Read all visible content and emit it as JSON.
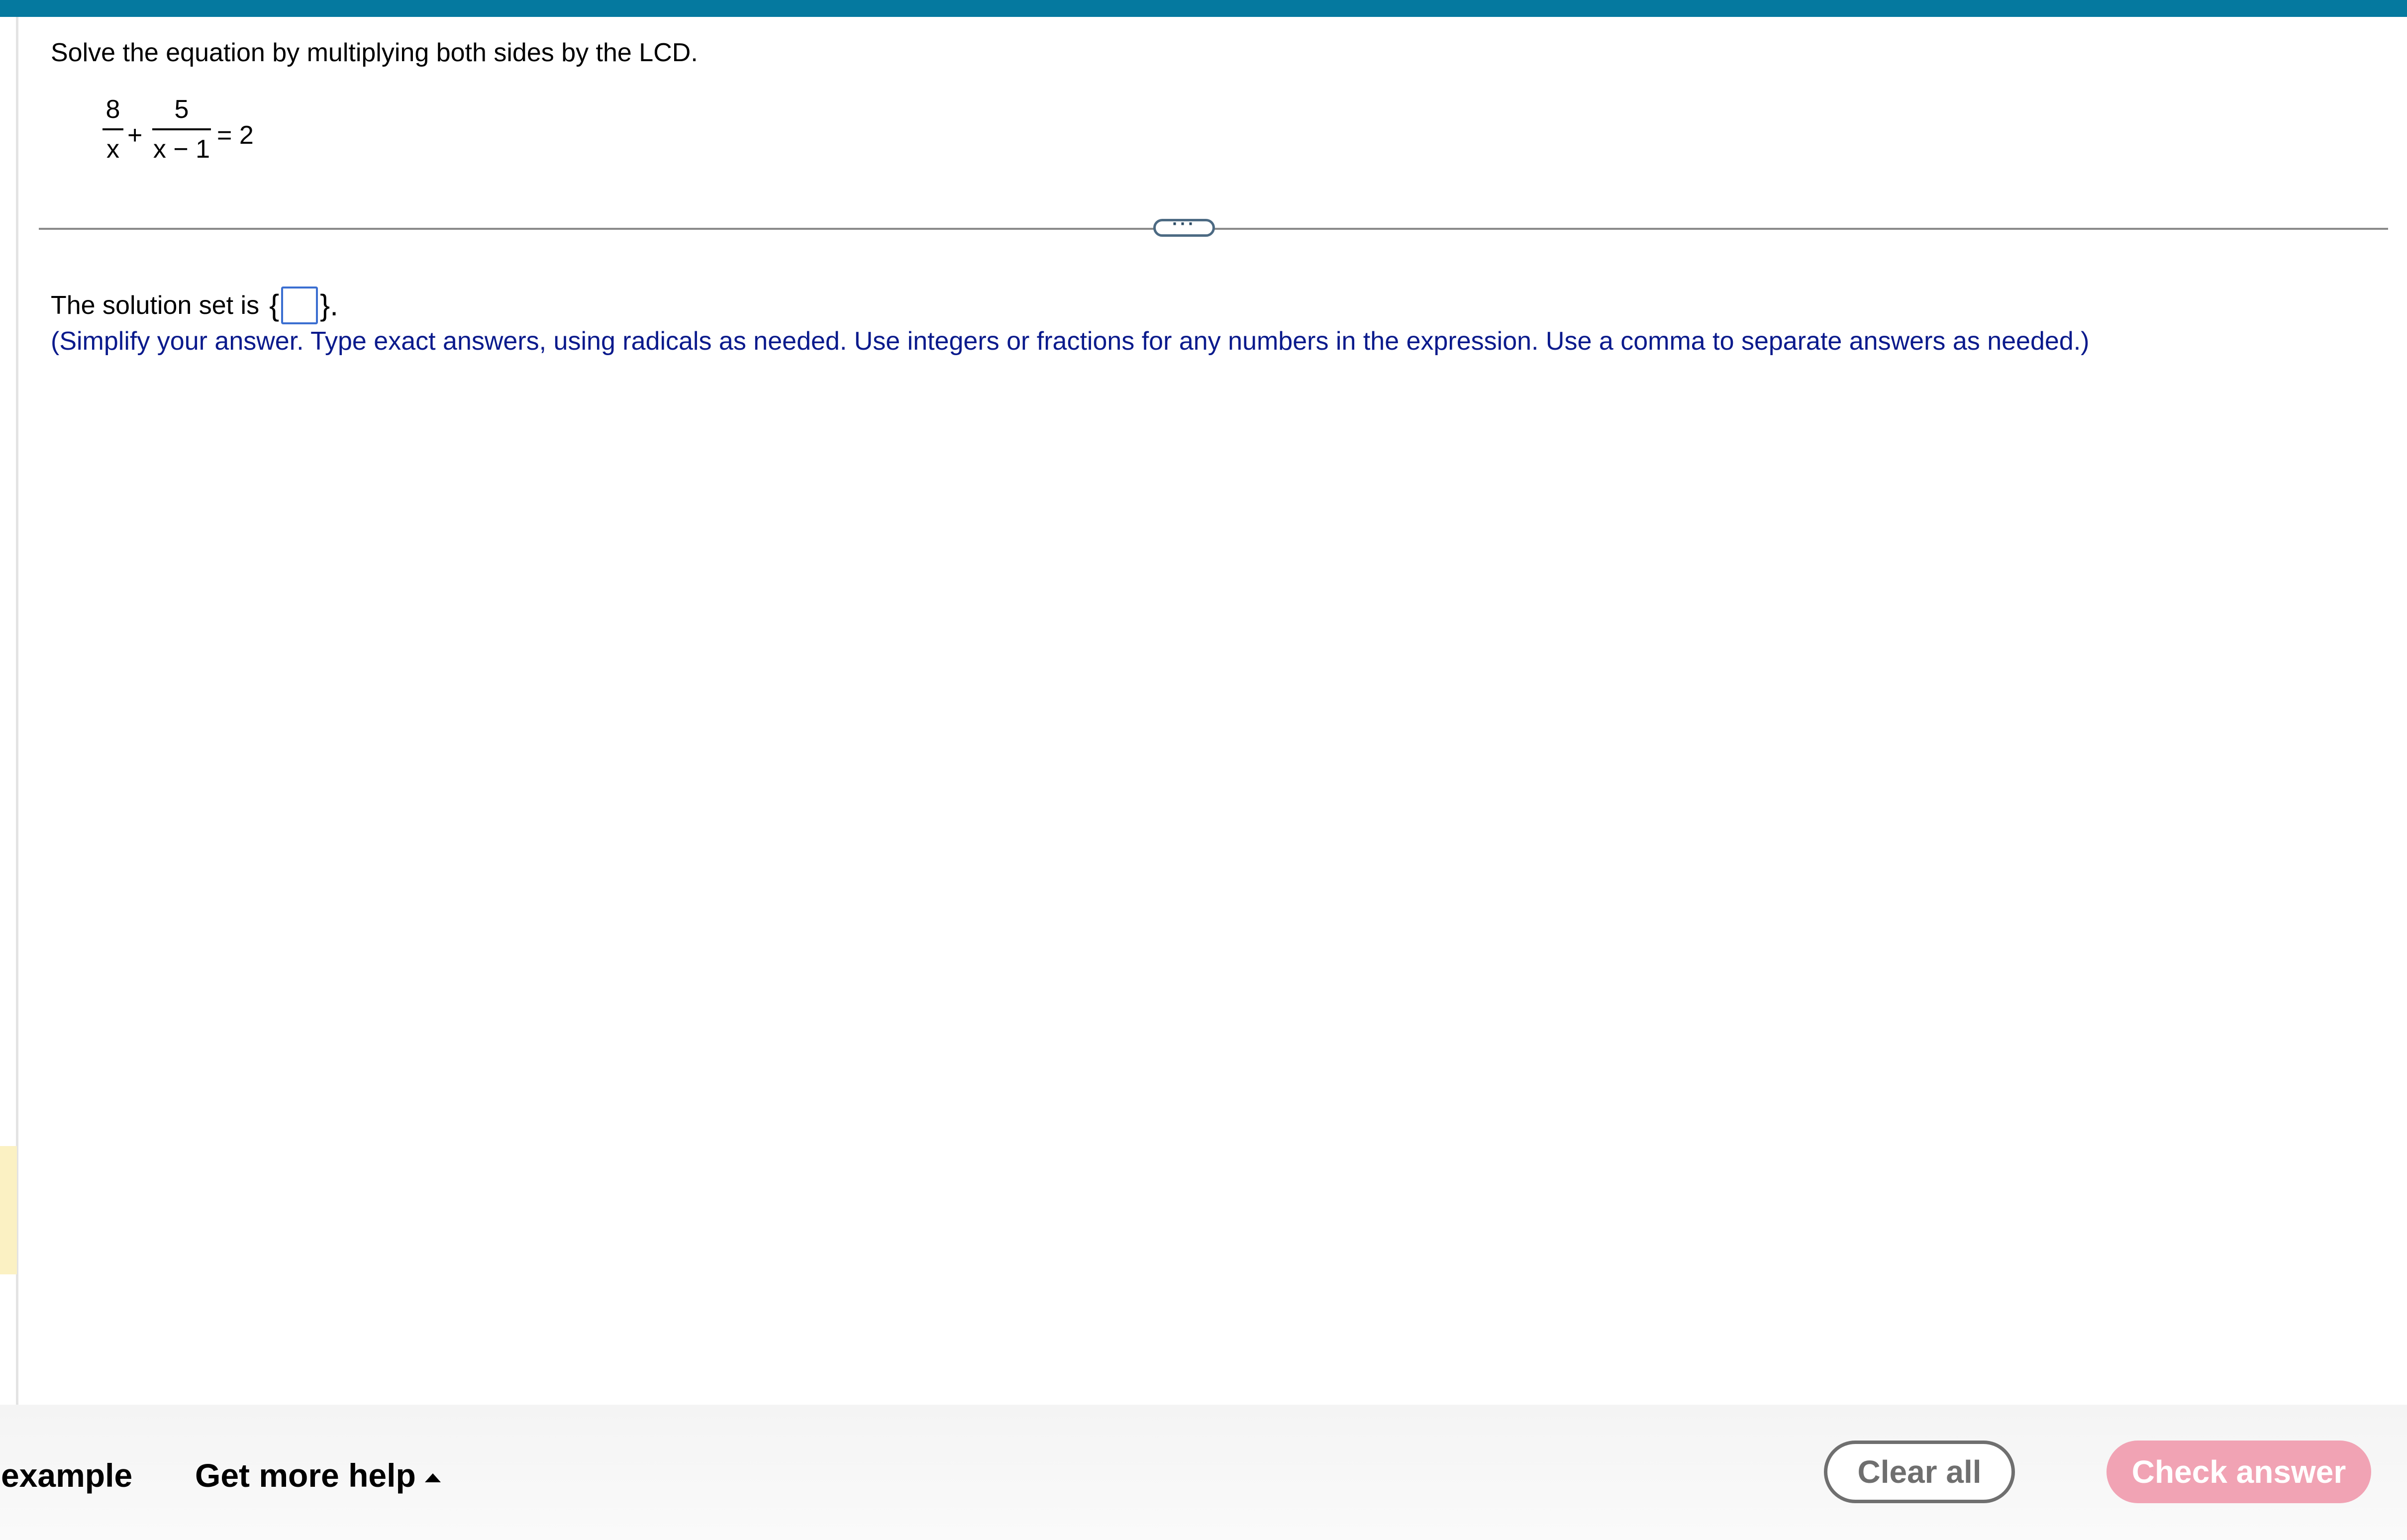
{
  "colors": {
    "top_bar": "#05799f",
    "hint_text": "#0a1a8c",
    "answer_box_border": "#3b6fd1",
    "check_answer_bg": "#f1a3b4",
    "clear_all_border": "#6f6f6f",
    "left_highlight": "#fbf1c3"
  },
  "question": {
    "instruction": "Solve the equation by multiplying both sides by the LCD.",
    "equation": {
      "frac1_num": "8",
      "frac1_den": "x",
      "plus": "+",
      "frac2_num": "5",
      "frac2_den": "x − 1",
      "equals": "= 2"
    }
  },
  "divider": {
    "expand_icon": "ellipsis-icon",
    "expand_label": "···"
  },
  "answer": {
    "prefix": "The solution set is",
    "open_brace": "{",
    "close_brace": "}.",
    "hint": "(Simplify your answer. Type exact answers, using radicals as needed. Use integers or fractions for any numbers in the expression. Use a comma to separate answers as needed.)"
  },
  "footer": {
    "example_label": "example",
    "help_label": "Get more help",
    "help_icon": "caret-up-icon",
    "clear_label": "Clear all",
    "check_label": "Check answer"
  }
}
